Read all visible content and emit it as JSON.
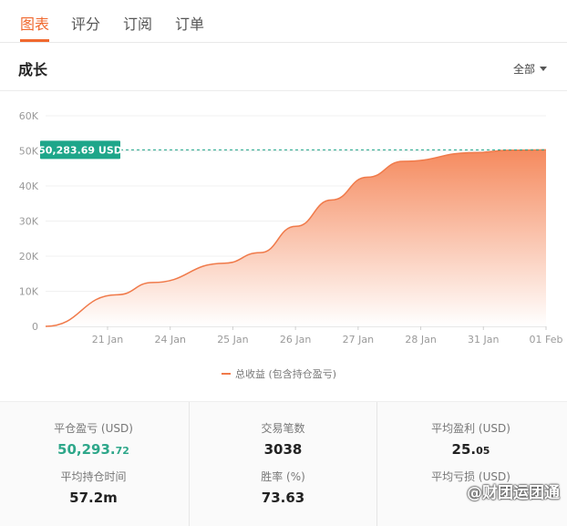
{
  "tabs": [
    {
      "label": "图表",
      "active": true
    },
    {
      "label": "评分",
      "active": false
    },
    {
      "label": "订阅",
      "active": false
    },
    {
      "label": "订单",
      "active": false
    }
  ],
  "section": {
    "title": "成长",
    "range_label": "全部"
  },
  "chart_data": {
    "type": "area",
    "x": [
      "2016-01-18",
      "2016-01-20",
      "2016-01-21",
      "2016-01-23",
      "2016-01-24",
      "2016-01-25",
      "2016-01-26",
      "2016-01-27",
      "2016-01-28",
      "2016-01-30",
      "2016-01-31",
      "2016-02-01"
    ],
    "series": [
      {
        "name": "总收益 (包含持仓盈亏)",
        "values": [
          0,
          9000,
          12500,
          18000,
          21000,
          28500,
          36000,
          42500,
          47000,
          49500,
          50200,
          50283.69
        ]
      }
    ],
    "x_tick_labels": [
      "21 Jan",
      "24 Jan",
      "25 Jan",
      "26 Jan",
      "27 Jan",
      "28 Jan",
      "31 Jan",
      "01 Feb"
    ],
    "y_tick_labels": [
      "0",
      "10K",
      "20K",
      "30K",
      "40K",
      "50K",
      "60K"
    ],
    "ylim": [
      0,
      60000
    ],
    "current_value_label": "50,283.69 USD",
    "current_value": 50283.69,
    "legend_position": "bottom",
    "colors": {
      "line": "#f07a4a",
      "fill_top": "#f58a5e",
      "fill_bottom": "#ffffff",
      "marker": "#1ea68a"
    }
  },
  "stats": {
    "closed_pl": {
      "label": "平仓盈亏 (USD)",
      "value_main": "50,293.",
      "value_dec": "72"
    },
    "avg_hold": {
      "label": "平均持仓时间",
      "value": "57.2m"
    },
    "trades": {
      "label": "交易笔数",
      "value": "3038"
    },
    "win_rate": {
      "label": "胜率 (%)",
      "value": "73.63"
    },
    "avg_profit": {
      "label": "平均盈利 (USD)",
      "value_main": "25.",
      "value_dec": "05"
    },
    "avg_loss": {
      "label": "平均亏损 (USD)"
    }
  },
  "watermark": "@财团运团通"
}
